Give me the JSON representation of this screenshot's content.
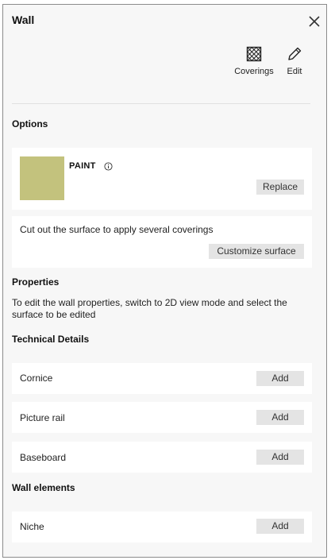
{
  "header": {
    "title": "Wall"
  },
  "toolbar": {
    "coverings_label": "Coverings",
    "edit_label": "Edit"
  },
  "options": {
    "heading": "Options",
    "paint": {
      "label": "PAINT",
      "color": "#c3c27d",
      "replace_label": "Replace"
    },
    "surface": {
      "text": "Cut out the surface to apply several coverings",
      "button_label": "Customize surface"
    }
  },
  "properties": {
    "heading": "Properties",
    "text": "To edit the wall properties, switch to 2D view mode and select the surface to be edited"
  },
  "technical": {
    "heading": "Technical Details",
    "items": [
      {
        "label": "Cornice",
        "button": "Add"
      },
      {
        "label": "Picture rail",
        "button": "Add"
      },
      {
        "label": "Baseboard",
        "button": "Add"
      }
    ]
  },
  "wall_elements": {
    "heading": "Wall elements",
    "items": [
      {
        "label": "Niche",
        "button": "Add"
      }
    ]
  }
}
